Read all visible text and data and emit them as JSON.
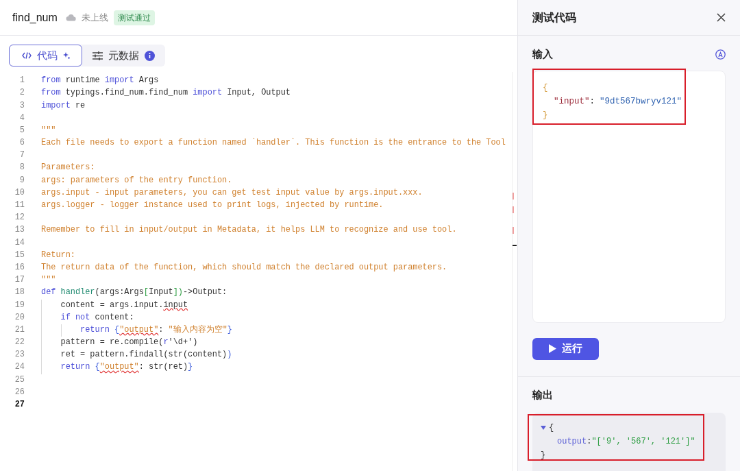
{
  "header": {
    "title": "find_num",
    "status": "未上线",
    "badge": "测试通过"
  },
  "tabs": [
    {
      "label": "代码",
      "kind": "code",
      "selected": true
    },
    {
      "label": "元数据",
      "kind": "metadata",
      "selected": false
    }
  ],
  "editor": {
    "lines": [
      {
        "number": "1",
        "current": false,
        "tokens": [
          {
            "text": "from",
            "kind": "keyword"
          },
          {
            "text": " runtime ",
            "kind": "plain"
          },
          {
            "text": "import",
            "kind": "keyword"
          },
          {
            "text": " Args",
            "kind": "plain"
          }
        ]
      },
      {
        "number": "2",
        "current": false,
        "tokens": [
          {
            "text": "from",
            "kind": "keyword"
          },
          {
            "text": " typings.find_num.find_num ",
            "kind": "plain"
          },
          {
            "text": "import",
            "kind": "keyword"
          },
          {
            "text": " Input, Output",
            "kind": "plain"
          }
        ]
      },
      {
        "number": "3",
        "current": false,
        "tokens": [
          {
            "text": "import",
            "kind": "keyword"
          },
          {
            "text": " re",
            "kind": "plain"
          }
        ]
      },
      {
        "number": "4",
        "current": false
      },
      {
        "number": "5",
        "current": false,
        "tokens": [
          {
            "text": "\"\"\"",
            "kind": "doc"
          }
        ]
      },
      {
        "number": "6",
        "current": false,
        "tokens": [
          {
            "text": "Each file needs to export a function named `handler`. This function is the entrance to the Tool",
            "kind": "doc"
          }
        ]
      },
      {
        "number": "7",
        "current": false
      },
      {
        "number": "8",
        "current": false,
        "tokens": [
          {
            "text": "Parameters:",
            "kind": "doc"
          }
        ]
      },
      {
        "number": "9",
        "current": false,
        "tokens": [
          {
            "text": "args: parameters of the entry function.",
            "kind": "doc"
          }
        ]
      },
      {
        "number": "10",
        "current": false,
        "tokens": [
          {
            "text": "args.input - input parameters, you can get test input value by args.input.xxx.",
            "kind": "doc"
          }
        ]
      },
      {
        "number": "11",
        "current": false,
        "tokens": [
          {
            "text": "args.logger - logger instance used to print logs, injected by runtime.",
            "kind": "doc"
          }
        ]
      },
      {
        "number": "12",
        "current": false
      },
      {
        "number": "13",
        "current": false,
        "tokens": [
          {
            "text": "Remember to fill in input/output in Metadata, it helps LLM to recognize and use tool.",
            "kind": "doc"
          }
        ]
      },
      {
        "number": "14",
        "current": false
      },
      {
        "number": "15",
        "current": false,
        "tokens": [
          {
            "text": "Return:",
            "kind": "doc"
          }
        ]
      },
      {
        "number": "16",
        "current": false,
        "tokens": [
          {
            "text": "The return data of the function, which should match the declared output parameters.",
            "kind": "doc"
          }
        ]
      },
      {
        "number": "17",
        "current": false,
        "tokens": [
          {
            "text": "\"\"\"",
            "kind": "doc"
          }
        ]
      },
      {
        "number": "18",
        "current": false,
        "tokens": [
          {
            "text": "def ",
            "kind": "keyword"
          },
          {
            "text": "handler",
            "kind": "function"
          },
          {
            "text": "(args:Args",
            "kind": "plain"
          },
          {
            "text": "[",
            "kind": "bracket2"
          },
          {
            "text": "Input",
            "kind": "plain"
          },
          {
            "text": "])",
            "kind": "bracket2"
          },
          {
            "text": "->Output:",
            "kind": "plain"
          }
        ]
      },
      {
        "number": "19",
        "current": false,
        "tokens": [
          {
            "text": "    content = args.input.",
            "kind": "plain"
          },
          {
            "text": "input",
            "kind": "plain_error"
          }
        ]
      },
      {
        "number": "20",
        "current": false,
        "tokens": [
          {
            "text": "    if not",
            "kind": "keyword"
          },
          {
            "text": " content:",
            "kind": "plain"
          }
        ]
      },
      {
        "number": "21",
        "current": false,
        "tokens": [
          {
            "text": "        return",
            "kind": "keyword"
          },
          {
            "text": " {",
            "kind": "bracket"
          },
          {
            "text": "\"output\"",
            "kind": "string_error"
          },
          {
            "text": ": ",
            "kind": "plain"
          },
          {
            "text": "\"输入内容为空\"",
            "kind": "string"
          },
          {
            "text": "}",
            "kind": "bracket"
          }
        ]
      },
      {
        "number": "22",
        "current": false,
        "tokens": [
          {
            "text": "    pattern = re.compile(",
            "kind": "plain"
          },
          {
            "text": "r",
            "kind": "keyword"
          },
          {
            "text": "'\\d+')",
            "kind": "plain"
          }
        ]
      },
      {
        "number": "23",
        "current": false,
        "tokens": [
          {
            "text": "    ret = pattern.findall(str(content)",
            "kind": "plain"
          },
          {
            "text": ")",
            "kind": "bracket"
          }
        ]
      },
      {
        "number": "24",
        "current": false,
        "tokens": [
          {
            "text": "    return",
            "kind": "keyword"
          },
          {
            "text": " {",
            "kind": "bracket"
          },
          {
            "text": "\"output\"",
            "kind": "string_error"
          },
          {
            "text": ": str(ret)",
            "kind": "plain"
          },
          {
            "text": "}",
            "kind": "bracket"
          }
        ]
      },
      {
        "number": "25",
        "current": false
      },
      {
        "number": "26",
        "current": false
      },
      {
        "number": "27",
        "current": true
      }
    ]
  },
  "test_panel": {
    "title": "测试代码",
    "input": {
      "label": "输入",
      "highlighted": true,
      "open_brace": "{",
      "key": "\"input\"",
      "colon": ":",
      "value": "\"9dt567bwryv121\"",
      "close_brace": "}"
    },
    "run_button": "运行",
    "output": {
      "label": "输出",
      "highlighted": true,
      "expanded": true,
      "open_brace": "{",
      "key": "output",
      "colon": ":",
      "value": "\"['9', '567', '121']\"",
      "close_brace": "}"
    }
  }
}
